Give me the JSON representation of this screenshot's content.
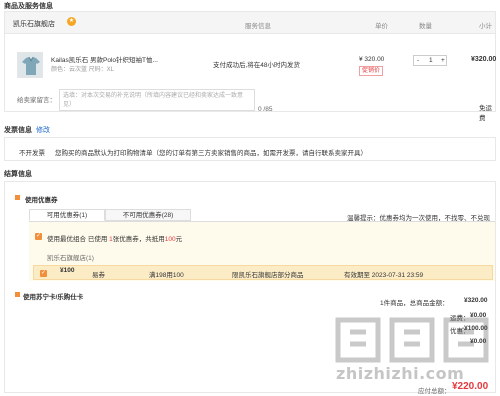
{
  "section_titles": {
    "goods": "商品及服务信息",
    "invoice": "发票信息",
    "settle": "结算信息"
  },
  "order_table": {
    "shop_name": "凯乐石旗舰店",
    "headers": {
      "service": "服务信息",
      "price": "单价",
      "qty": "数量",
      "subtotal": "小计"
    },
    "product": {
      "name": "Kailas凯乐石 男款Polo针织短袖T恤...",
      "spec": "颜色：云次蓝  尺码：XL",
      "service": "支付成功后,将在48小时内发货",
      "price": "¥ 320.00",
      "promo_tag": "促销价",
      "qty_minus": "-",
      "qty_value": "1",
      "qty_plus": "+",
      "subtotal": "¥320.00"
    },
    "message_label": "给卖家留言：",
    "message_placeholder": "选填：对本次交易的补充说明（所填内容建议已经和卖家达成一致意见）",
    "message_count": "0 /85",
    "shipping_fee": "免运费"
  },
  "invoice": {
    "edit_link": "修改",
    "type": "不开发票",
    "notice": "您购买的商品默认为打印购物清单（您的订单有第三方卖家销售的商品，如需开发票，请自行联系卖家开具）"
  },
  "settle": {
    "coupon_section_title": "使用优惠券",
    "tabs": [
      "可用优惠券(1)",
      "不可用优惠券(28)"
    ],
    "tip": "温馨提示：优惠券均为一次使用，不找零、不兑现",
    "use_best_prefix": "使用最优组合",
    "use_best_mid": "已使用",
    "use_best_count": "1",
    "use_best_mid2": "张优惠券，共抵用",
    "use_best_amount": "100",
    "use_best_suffix": "元",
    "shop_coupon_label": "凯乐石旗舰店(1)",
    "coupon": {
      "value": "¥100",
      "type": "易券",
      "condition": "满198用100",
      "scope": "限凯乐石旗舰店部分商品",
      "validity": "有效期至 2023-07-31 23:59"
    },
    "suning_card_label": "使用苏宁卡/乐购仕卡"
  },
  "summary": {
    "count_label": "1件商品，总商品金额：",
    "goods_total": "¥320.00",
    "freight_label": "运费：",
    "freight": "¥0.00",
    "discount_label": "优惠：",
    "discount": "-¥100.00",
    "other_label": "",
    "other": "¥0.00",
    "total_label": "应付总额：",
    "total": "¥220.00"
  },
  "watermark": "zhizhizhi.com",
  "colors": {
    "accent_orange": "#f18f3b",
    "price_red": "#e4393c",
    "link_blue": "#1a66cc"
  }
}
